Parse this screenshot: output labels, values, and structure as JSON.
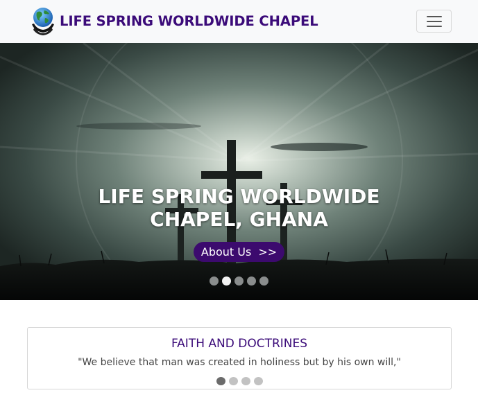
{
  "brand": {
    "name": "LIFE SPRING WORLDWIDE CHAPEL",
    "logo": "globe-in-hands-logo",
    "color": "#3b0b79"
  },
  "navbar": {
    "toggle_icon": "hamburger-menu-icon"
  },
  "hero": {
    "title_line1": "LIFE SPRING WORLDWIDE",
    "title_line2": "CHAPEL, GHANA",
    "button_label": "About Us",
    "button_arrow": ">>",
    "button_color": "#3c0a6e",
    "indicators": {
      "count": 5,
      "active_index": 1
    }
  },
  "faith_card": {
    "title": "FAITH AND DOCTRINES",
    "quote": "\"We believe that man was created in holiness but by his own will,\"",
    "indicators": {
      "count": 4,
      "active_index": 0
    }
  }
}
